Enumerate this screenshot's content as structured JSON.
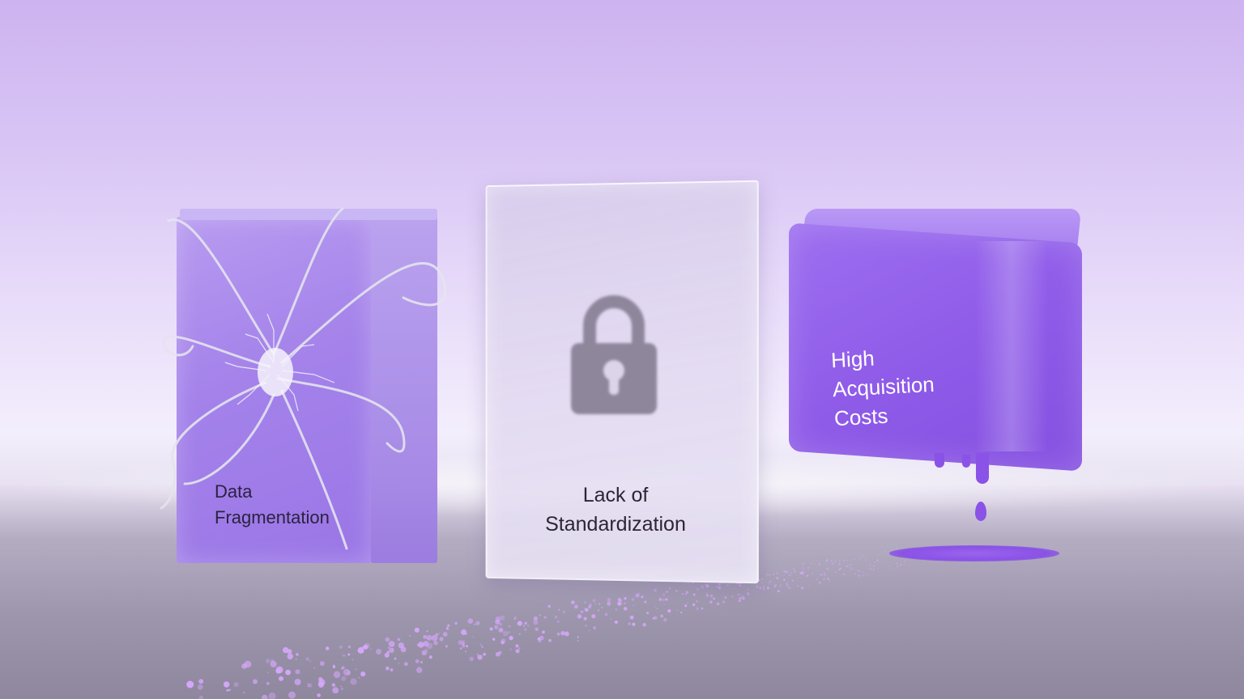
{
  "scene": {
    "blocks": [
      {
        "id": "fragmentation",
        "label_line1": "Data",
        "label_line2": "Fragmentation"
      },
      {
        "id": "standardization",
        "label_line1": "Lack of",
        "label_line2": "Standardization"
      },
      {
        "id": "costs",
        "label_line1": "High",
        "label_line2": "Acquisition",
        "label_line3": "Costs"
      }
    ],
    "colors": {
      "accent_purple": "#8a52e6",
      "light_purple": "#a482ea",
      "background_top": "#cdb3f0"
    },
    "icons": [
      "cracked-glass-icon",
      "lock-icon",
      "dripping-liquid-icon"
    ]
  }
}
